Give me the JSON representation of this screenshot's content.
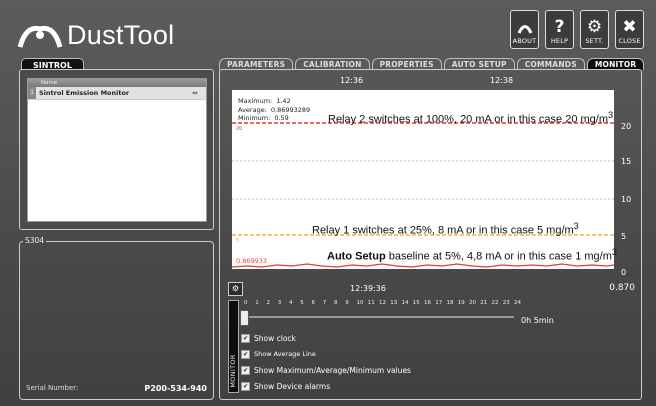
{
  "app": {
    "title": "DustTool",
    "buttons": [
      {
        "label": "ABOUT",
        "icon": "about-icon"
      },
      {
        "label": "HELP",
        "icon": "help-icon"
      },
      {
        "label": "SETT.",
        "icon": "settings-gear-icon"
      },
      {
        "label": "CLOSE",
        "icon": "close-icon"
      }
    ]
  },
  "left": {
    "tab": "SINTROL",
    "list_header": "Name",
    "devices": [
      {
        "index": "1",
        "name": "Sintrol Emission Monitor",
        "icon": "usb-icon"
      }
    ],
    "group_legend": "S304",
    "serial_label": "Serial Number:",
    "serial_value": "P200-534-940"
  },
  "tabs": [
    "PARAMETERS",
    "CALIBRATION",
    "PROPERTIES",
    "AUTO SETUP",
    "COMMANDS",
    "MONITOR"
  ],
  "active_tab": "MONITOR",
  "monitor": {
    "time_labels": [
      "12:36",
      "12:38"
    ],
    "stats": {
      "max_label": "Maximum:",
      "max_value": "1.42",
      "avg_label": "Average:",
      "avg_value": "0.86993289",
      "min_label": "Minimum:",
      "min_value": "0.59"
    },
    "relay2_text": "Relay 2 switches at 100%, 20 mA or in this case 20 mg/m",
    "relay1_text": "Relay 1 switches at 25%, 8 mA or in this case 5 mg/m",
    "baseline_bold": "Auto Setup",
    "baseline_text": " baseline at 5%, 4,8 mA or in this case 1 mg/m",
    "sup3": "3",
    "baseline_value": "0.869933",
    "left_tick_20": "20",
    "left_tick_5": "5",
    "y_ticks": [
      "20",
      "15",
      "10",
      "5",
      "0"
    ],
    "clock": "12:39:36",
    "current_value": "0.870",
    "scale_numbers": [
      "0",
      "1",
      "2",
      "3",
      "4",
      "5",
      "6",
      "7",
      "8",
      "9",
      "10",
      "11",
      "12",
      "13",
      "14",
      "15",
      "16",
      "17",
      "18",
      "19",
      "20",
      "21",
      "22",
      "23",
      "24"
    ],
    "duration": "0h 5min",
    "side_label": "MONITOR",
    "options": [
      {
        "label": "Show clock",
        "checked": true
      },
      {
        "label": "Show Average Line",
        "checked": true
      },
      {
        "label": "Show Maximum/Average/Minimum values",
        "checked": true
      },
      {
        "label": "Show Device alarms",
        "checked": true
      }
    ]
  },
  "colors": {
    "relay2_line": "#e03a3a",
    "relay1_line": "#f2b23a",
    "signal_line": "#e03a3a"
  }
}
